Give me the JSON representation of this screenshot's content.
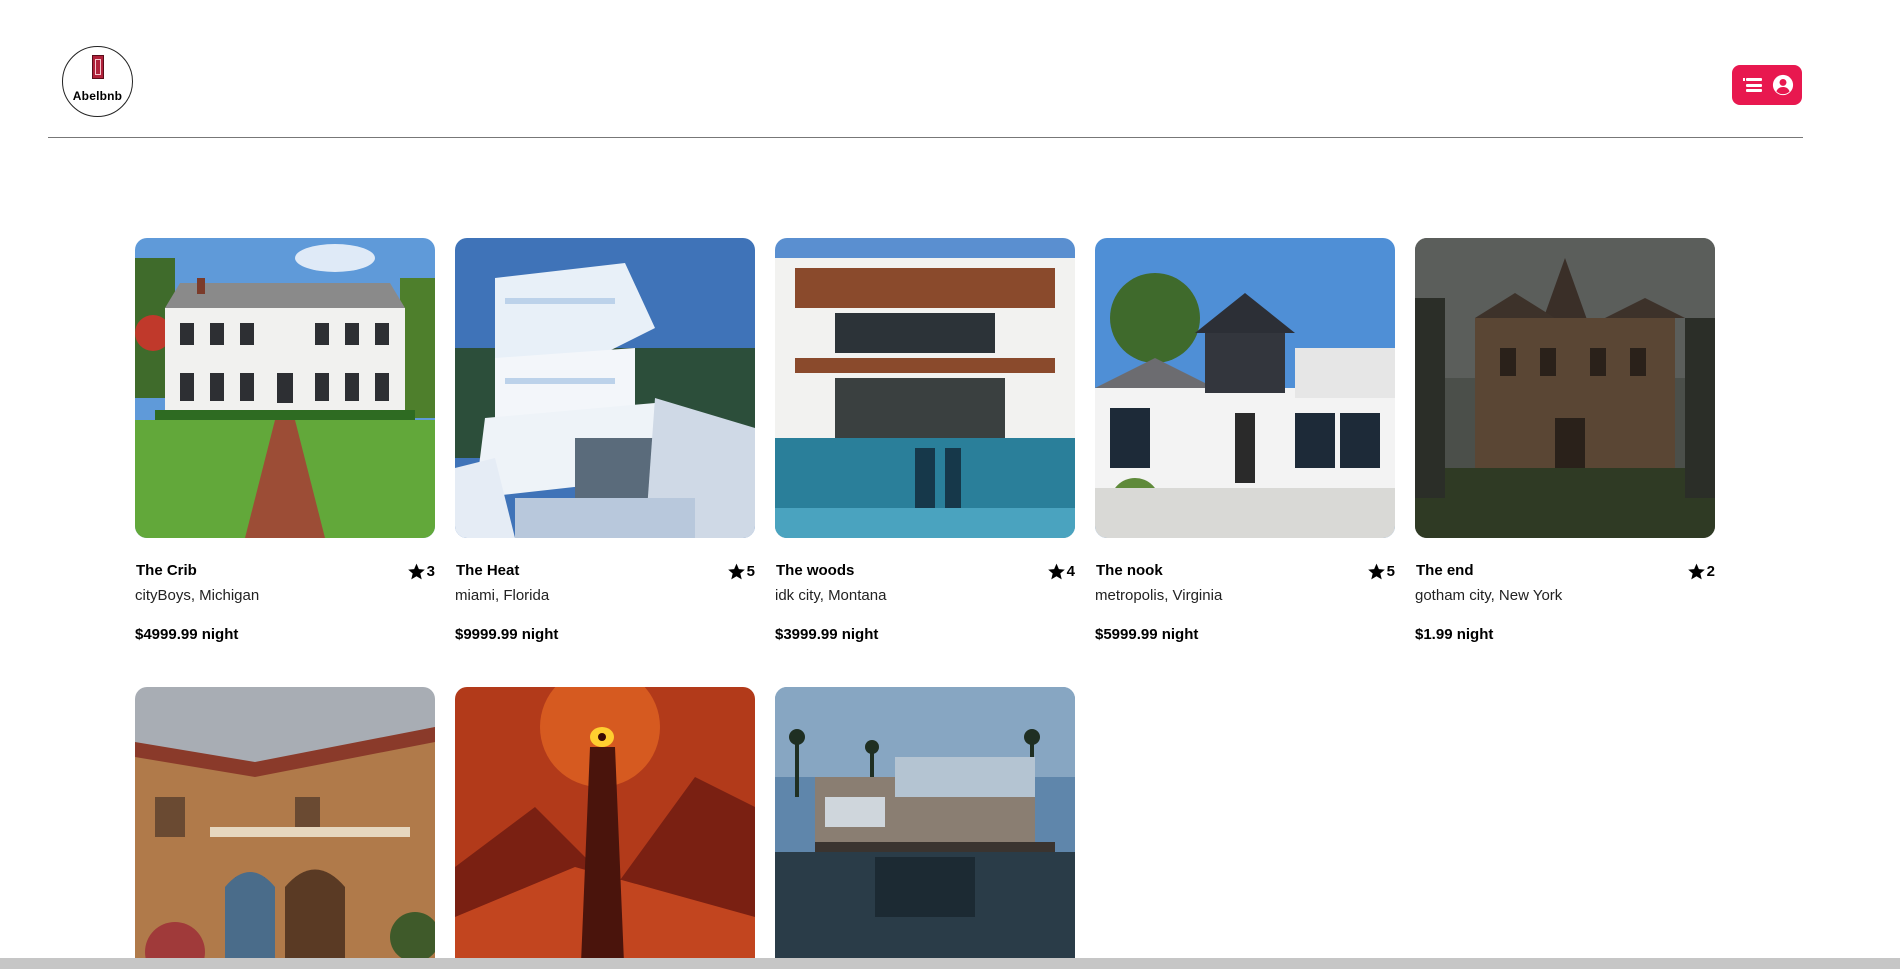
{
  "header": {
    "logo_text": "Abelbnb",
    "brand_color": "#e8184f",
    "menu_icon": "hamburger-icon",
    "user_icon": "user-circle-icon"
  },
  "listings": [
    {
      "title": "The Crib",
      "rating": "3",
      "location": "cityBoys, Michigan",
      "price": "$4999.99 night",
      "image": "white colonial house with lawn"
    },
    {
      "title": "The Heat",
      "rating": "5",
      "location": "miami, Florida",
      "price": "$9999.99 night",
      "image": "modern white cliffside house"
    },
    {
      "title": "The woods",
      "rating": "4",
      "location": "idk city, Montana",
      "price": "$3999.99 night",
      "image": "modern villa with pool"
    },
    {
      "title": "The nook",
      "rating": "5",
      "location": "metropolis, Virginia",
      "price": "$5999.99 night",
      "image": "modern farmhouse"
    },
    {
      "title": "The end",
      "rating": "2",
      "location": "gotham city, New York",
      "price": "$1.99 night",
      "image": "abandoned gothic mansion"
    },
    {
      "title": "",
      "rating": "",
      "location": "",
      "price": "",
      "image": "old italian villa courtyard"
    },
    {
      "title": "",
      "rating": "",
      "location": "",
      "price": "",
      "image": "dark tower with fiery eye"
    },
    {
      "title": "",
      "rating": "",
      "location": "",
      "price": "",
      "image": "modern glass house on water"
    }
  ]
}
